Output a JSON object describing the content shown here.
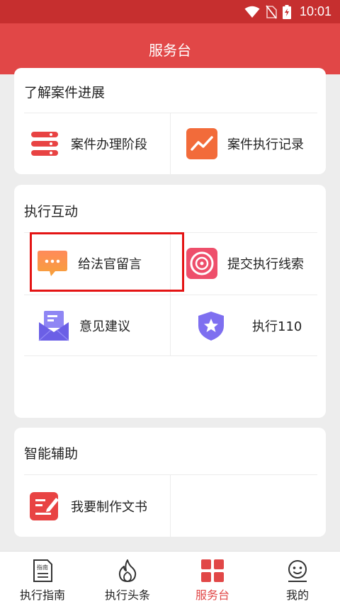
{
  "status_bar": {
    "time": "10:01"
  },
  "header": {
    "title": "服务台"
  },
  "section_progress": {
    "title": "了解案件进展",
    "items": [
      {
        "label": "案件办理阶段",
        "icon": "list-icon"
      },
      {
        "label": "案件执行记录",
        "icon": "trend-chart-icon"
      }
    ]
  },
  "section_interaction": {
    "title": "执行互动",
    "items": [
      {
        "label": "给法官留言",
        "icon": "chat-bubble-icon"
      },
      {
        "label": "提交执行线索",
        "icon": "vinyl-disc-icon"
      },
      {
        "label": "意见建议",
        "icon": "envelope-icon"
      },
      {
        "label": "执行110",
        "icon": "shield-star-icon"
      }
    ]
  },
  "section_assist": {
    "title": "智能辅助",
    "items": [
      {
        "label": "我要制作文书",
        "icon": "edit-document-icon"
      }
    ]
  },
  "tabbar": {
    "items": [
      {
        "label": "执行指南",
        "icon_text": "指南",
        "active": false
      },
      {
        "label": "执行头条",
        "active": false
      },
      {
        "label": "服务台",
        "active": true
      },
      {
        "label": "我的",
        "active": false
      }
    ]
  },
  "colors": {
    "primary": "#e14747",
    "status_bar": "#c62f2f",
    "highlight_border": "#e41414"
  }
}
